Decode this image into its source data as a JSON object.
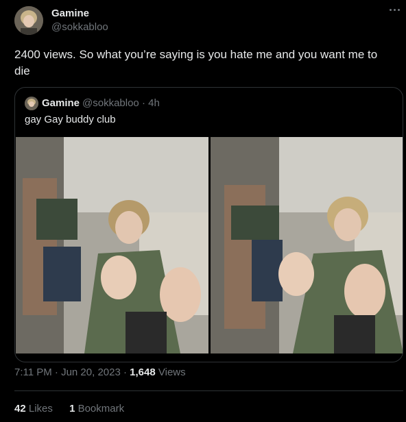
{
  "author": {
    "name": "Gamine",
    "handle": "@sokkabloo"
  },
  "tweet": {
    "text": "2400 views. So what you’re saying is you hate me and you want me to die",
    "time": "7:11 PM · Jun 20, 2023",
    "separator": " · ",
    "views_count": "1,648",
    "views_label": "Views"
  },
  "quoted_tweet": {
    "name": "Gamine",
    "handle_time": "@sokkabloo · 4h",
    "text": "gay Gay buddy club",
    "images": [
      "photo",
      "photo"
    ]
  },
  "stats": {
    "likes_count": "42",
    "likes_label": "Likes",
    "bookmarks_count": "1",
    "bookmarks_label": "Bookmark"
  },
  "icons": {
    "more": "more-horizontal-icon"
  },
  "colors": {
    "background": "#000000",
    "text_primary": "#e7e9ea",
    "text_secondary": "#71767b",
    "border": "#2f3336"
  }
}
